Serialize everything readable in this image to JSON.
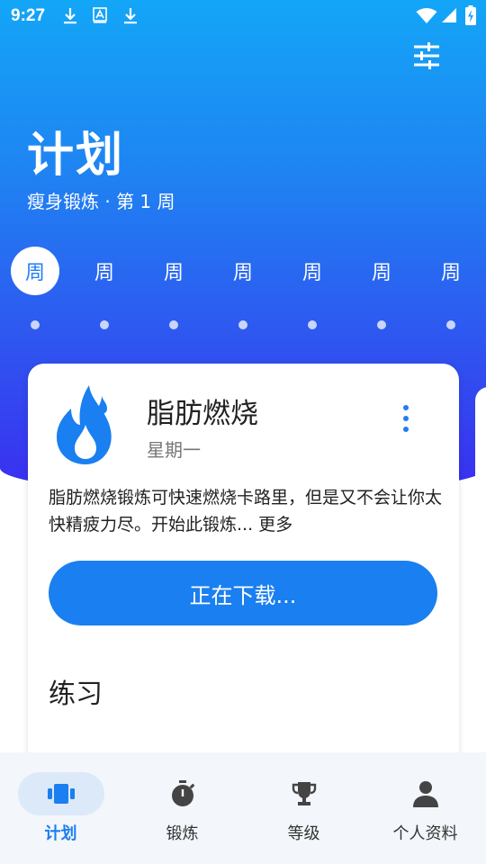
{
  "status_bar": {
    "time": "9:27",
    "icons": [
      "download-icon",
      "font-icon",
      "download-icon",
      "wifi-icon",
      "signal-icon",
      "battery-charging-icon"
    ]
  },
  "header": {
    "title": "计划",
    "subtitle": "瘦身锻炼 · 第 1 周",
    "filter_icon": "tune-icon"
  },
  "week": {
    "days": [
      "周",
      "周",
      "周",
      "周",
      "周",
      "周",
      "周"
    ],
    "active_index": 0
  },
  "card": {
    "icon": "flame-icon",
    "title": "脂肪燃烧",
    "day": "星期一",
    "description": "脂肪燃烧锻炼可快速燃烧卡路里，但是又不会让你太快精疲力尽。开始此锻炼...",
    "more_label": "更多",
    "action_label": "正在下载...",
    "section_title": "练习"
  },
  "tabbar": {
    "items": [
      {
        "label": "计划",
        "icon": "plan-icon",
        "active": true
      },
      {
        "label": "锻炼",
        "icon": "stopwatch-icon",
        "active": false
      },
      {
        "label": "等级",
        "icon": "trophy-icon",
        "active": false
      },
      {
        "label": "个人资料",
        "icon": "person-icon",
        "active": false
      }
    ]
  },
  "colors": {
    "accent": "#1a7ff0",
    "gradient_top": "#13a6f7",
    "gradient_bottom": "#3a2ef0"
  }
}
